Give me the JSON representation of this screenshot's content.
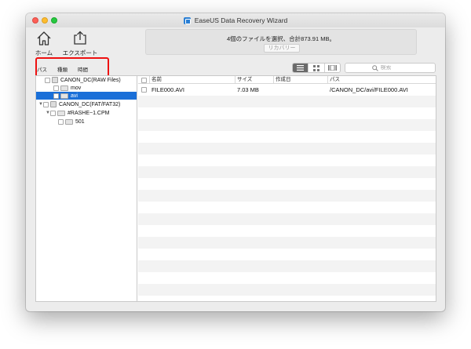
{
  "window": {
    "title": "EaseUS Data Recovery Wizard"
  },
  "toolbar": {
    "home_label": "ホーム",
    "export_label": "エクスポート"
  },
  "status": {
    "message": "4個のファイルを選択、合計873.91 MB。",
    "recover_label": "リカバリー"
  },
  "tabs": [
    {
      "label": "パス"
    },
    {
      "label": "種類"
    },
    {
      "label": "時間"
    }
  ],
  "search": {
    "placeholder": "検索"
  },
  "tree": {
    "root1": "CANON_DC(RAW Files)",
    "mov": "mov",
    "avi": "avi",
    "root2": "CANON_DC(FAT/FAT32)",
    "rashe": "#RASHE~1.CPM",
    "f501": "501"
  },
  "table": {
    "columns": [
      "名前",
      "サイズ",
      "作成日",
      "パス"
    ],
    "rows": [
      {
        "name": "FILE000.AVI",
        "size": "7.03 MB",
        "created": "",
        "path": "/CANON_DC/avi/FILE000.AVI"
      }
    ]
  },
  "colors": {
    "accent": "#1a6fd8",
    "highlight": "#ee1111"
  }
}
